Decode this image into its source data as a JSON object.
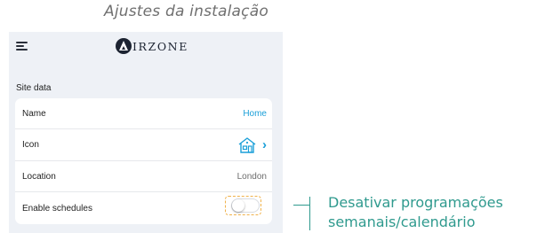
{
  "caption": "Ajustes da instalação",
  "header": {
    "menu_icon": "hamburger-menu-icon",
    "brand_text": "IRZONE",
    "brand_logo_icon": "airzone-logo-icon"
  },
  "section": {
    "label": "Site data"
  },
  "rows": {
    "name": {
      "label": "Name",
      "value": "Home"
    },
    "icon": {
      "label": "Icon",
      "icon": "house-icon",
      "chevron": "›"
    },
    "location": {
      "label": "Location",
      "value": "London"
    },
    "enable": {
      "label": "Enable schedules",
      "enabled": false
    }
  },
  "annotation": {
    "line1": "Desativar programações",
    "line2": "semanais/calendário"
  },
  "colors": {
    "accent": "#1a9fd8",
    "callout": "#2f9a8e",
    "highlight": "#f0b24a",
    "panel": "#eef1f6"
  }
}
